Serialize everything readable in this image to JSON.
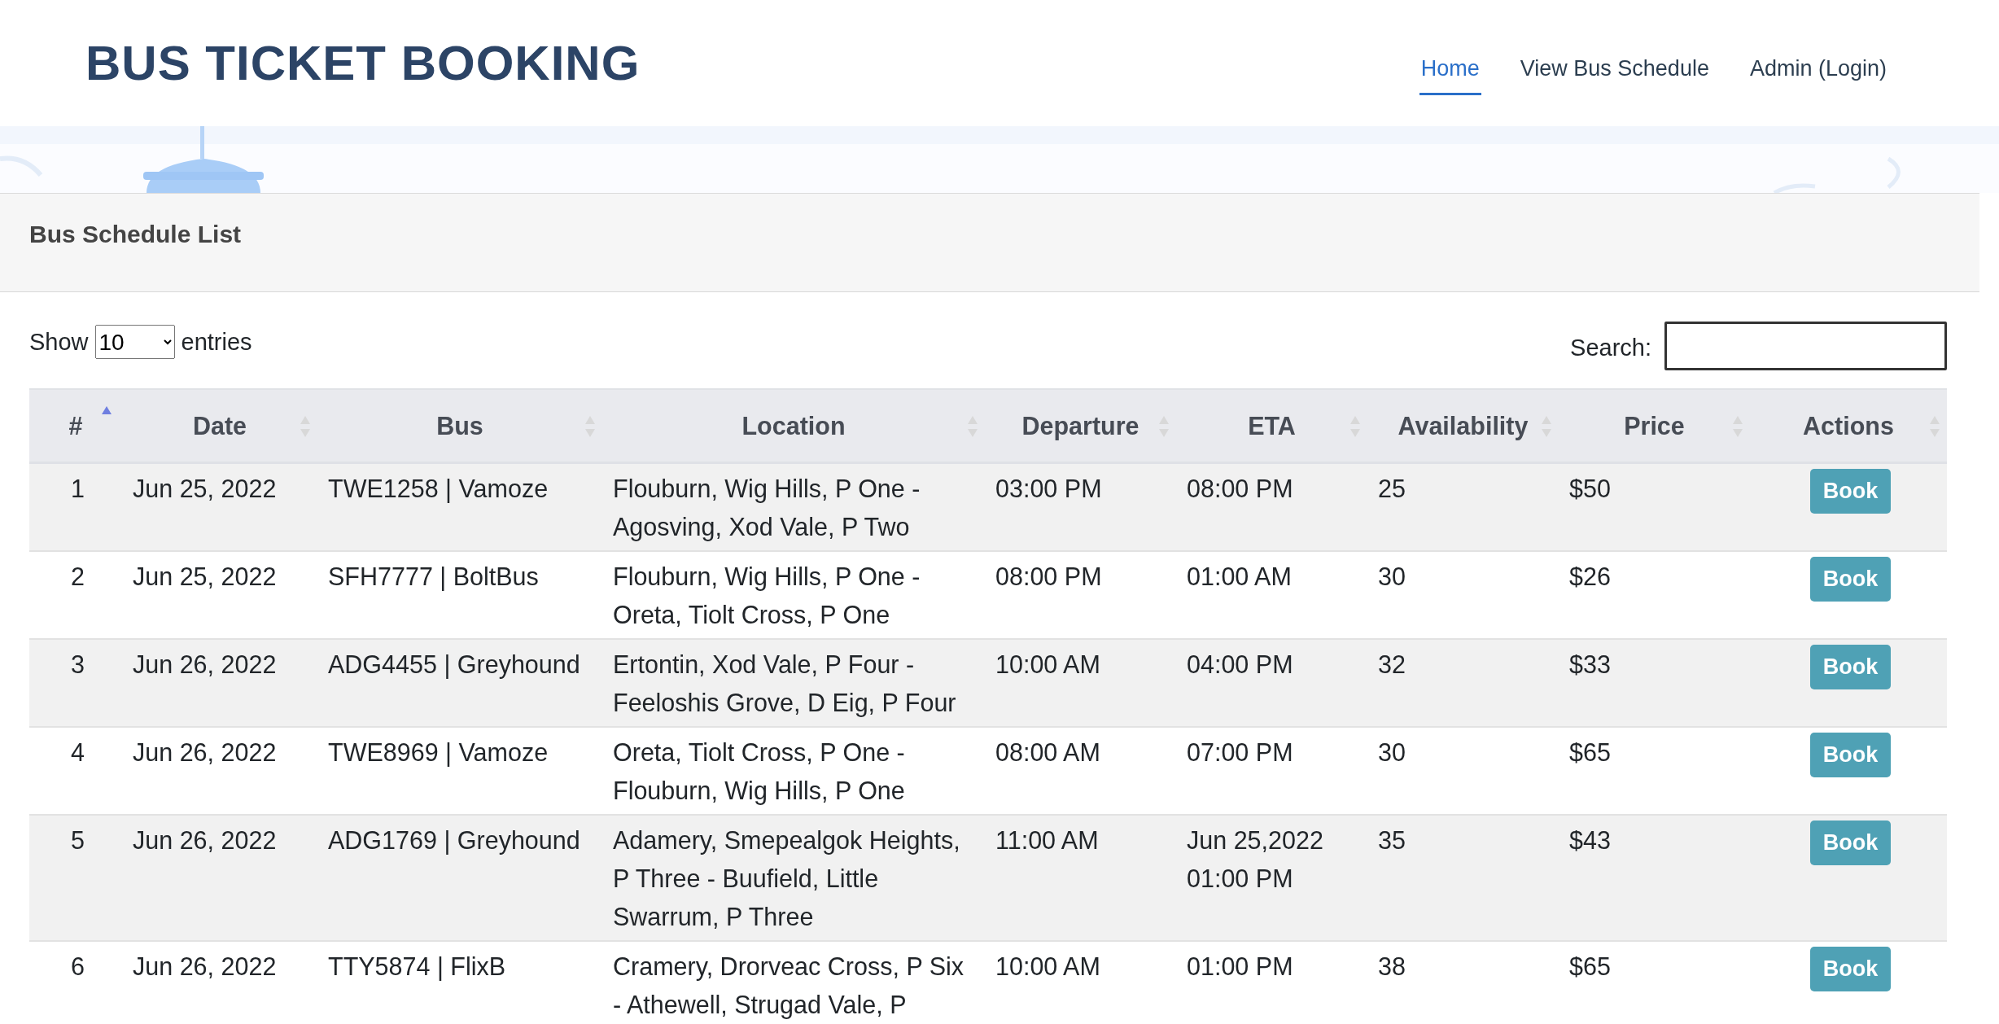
{
  "site_title": "BUS TICKET BOOKING",
  "nav": [
    {
      "label": "Home",
      "selected": true
    },
    {
      "label": "View Bus Schedule",
      "selected": false
    },
    {
      "label": "Admin (Login)",
      "selected": false
    }
  ],
  "panel": {
    "title": "Bus Schedule List"
  },
  "length_control": {
    "prefix": "Show",
    "value": "10",
    "suffix": "entries"
  },
  "search": {
    "label": "Search:"
  },
  "table": {
    "columns": [
      {
        "label": "#",
        "sorted": true
      },
      {
        "label": "Date",
        "sorted": false
      },
      {
        "label": "Bus",
        "sorted": false
      },
      {
        "label": "Location",
        "sorted": false
      },
      {
        "label": "Departure",
        "sorted": false
      },
      {
        "label": "ETA",
        "sorted": false
      },
      {
        "label": "Availability",
        "sorted": false
      },
      {
        "label": "Price",
        "sorted": false
      },
      {
        "label": "Actions",
        "sorted": false
      }
    ],
    "rows": [
      {
        "cells": [
          "1",
          "Jun 25, 2022",
          "TWE1258 | Vamoze",
          "Flouburn, Wig Hills, P One - Agosving, Xod Vale, P Two",
          "03:00 PM",
          "08:00 PM",
          "25",
          "$50"
        ],
        "action": "Book"
      },
      {
        "cells": [
          "2",
          "Jun 25, 2022",
          "SFH7777 | BoltBus",
          "Flouburn, Wig Hills, P One - Oreta, Tiolt Cross, P One",
          "08:00 PM",
          "01:00 AM",
          "30",
          "$26"
        ],
        "action": "Book"
      },
      {
        "cells": [
          "3",
          "Jun 26, 2022",
          "ADG4455 | Greyhound",
          "Ertontin, Xod Vale, P Four - Feeloshis Grove, D Eig, P Four",
          "10:00 AM",
          "04:00 PM",
          "32",
          "$33"
        ],
        "action": "Book"
      },
      {
        "cells": [
          "4",
          "Jun 26, 2022",
          "TWE8969 | Vamoze",
          "Oreta, Tiolt Cross, P One - Flouburn, Wig Hills, P One",
          "08:00 AM",
          "07:00 PM",
          "30",
          "$65"
        ],
        "action": "Book"
      },
      {
        "cells": [
          "5",
          "Jun 26, 2022",
          "ADG1769 | Greyhound",
          "Adamery, Smepealgok Heights, P Three - Buufield, Little Swarrum, P Three",
          "11:00 AM",
          "Jun 25,2022 01:00 PM",
          "35",
          "$43"
        ],
        "action": "Book"
      },
      {
        "cells": [
          "6",
          "Jun 26, 2022",
          "TTY5874 | FlixB",
          "Cramery, Drorveac Cross, P Six - Athewell, Strugad Vale, P",
          "10:00 AM",
          "01:00 PM",
          "38",
          "$65"
        ],
        "action": "Book"
      }
    ]
  }
}
